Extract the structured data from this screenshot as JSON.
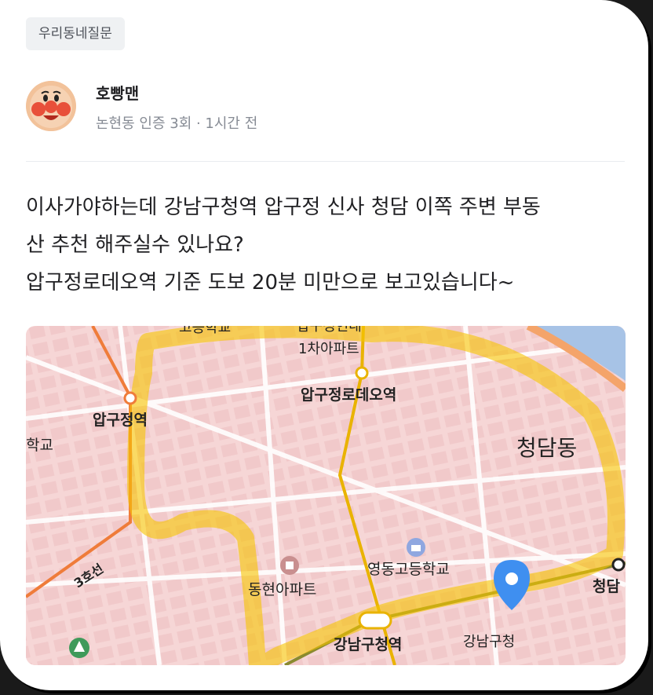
{
  "category_tag": "우리동네질문",
  "post": {
    "author": "호빵맨",
    "meta": "논현동 인증 3회 · 1시간 전",
    "body_line1": "이사가야하는데 강남구청역 압구정 신사 청담 이쪽 주변 부동",
    "body_line2": "산 추천 해주실수 있나요?",
    "body_line3": "압구정로데오역 기준 도보 20분 미만으로 보고있습니다~"
  },
  "map": {
    "labels": {
      "apgujeong_station": "압구정역",
      "apgujeong_rodeo_station": "압구정로데오역",
      "cheongdam_dong": "청담동",
      "apartment_1": "1차아파트",
      "school_left": "학교",
      "yeongdong_high": "영동고등학교",
      "donghyun_apt": "동현아파트",
      "gangnam_gu_office_station": "강남구청역",
      "gangnam_gu_office": "강남구청",
      "cheongdam": "청담",
      "line3": "3호선",
      "top_cut_left": "고등학교",
      "top_cut_mid": "압구정현대"
    },
    "colors": {
      "background": "#f7d9d9",
      "highlight": "#f7c400",
      "line3": "#ef7c3a",
      "suin_bundang": "#e9b300",
      "line7": "#8a8a2f",
      "river": "#a7c3e6",
      "pin": "#3f8ff0"
    }
  }
}
